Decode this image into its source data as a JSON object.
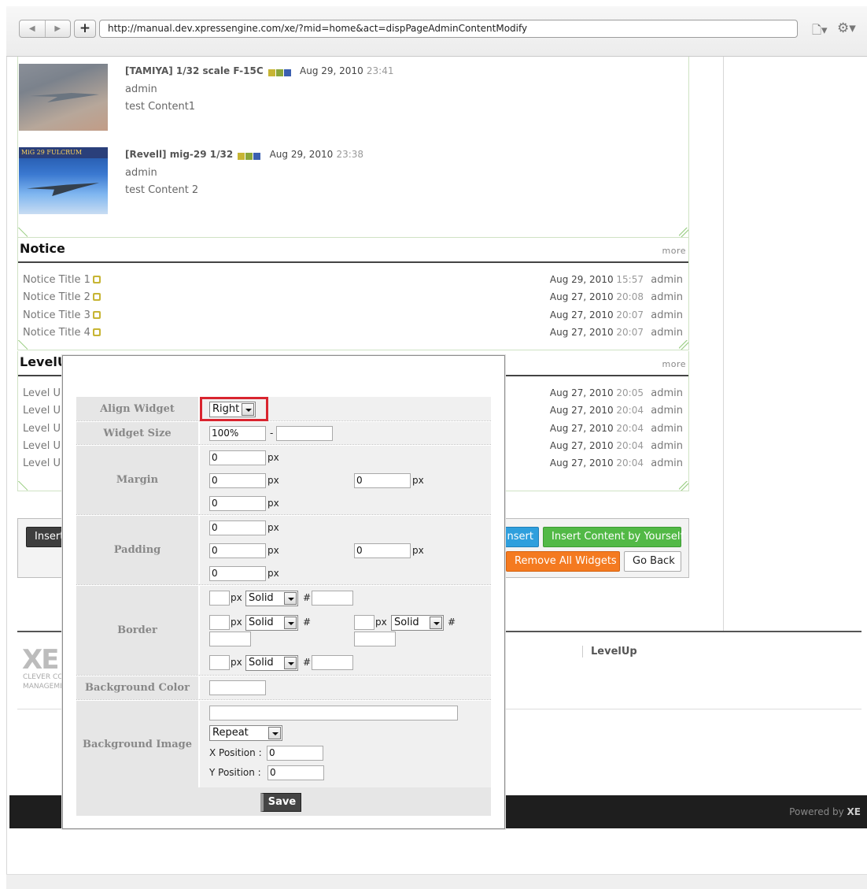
{
  "browser": {
    "url": "http://manual.dev.xpressengine.com/xe/?mid=home&act=dispPageAdminContentModify"
  },
  "gallery": {
    "items": [
      {
        "title": "[TAMIYA] 1/32 scale F-15C",
        "date": "Aug 29, 2010",
        "time": "23:41",
        "author": "admin",
        "content": "test Content1"
      },
      {
        "title": "[Revell] mig-29 1/32",
        "date": "Aug 29, 2010",
        "time": "23:38",
        "author": "admin",
        "content": "test Content 2",
        "thumb_caption": "MiG 29 FULCRUM"
      }
    ]
  },
  "notice": {
    "title": "Notice",
    "more": "more",
    "rows": [
      {
        "title": "Notice Title 1",
        "date": "Aug 29, 2010",
        "time": "15:57",
        "author": "admin"
      },
      {
        "title": "Notice Title 2",
        "date": "Aug 27, 2010",
        "time": "20:08",
        "author": "admin"
      },
      {
        "title": "Notice Title 3",
        "date": "Aug 27, 2010",
        "time": "20:07",
        "author": "admin"
      },
      {
        "title": "Notice Title 4",
        "date": "Aug 27, 2010",
        "time": "20:07",
        "author": "admin"
      }
    ]
  },
  "levelup": {
    "title": "LevelU",
    "more": "more",
    "rows": [
      {
        "title": "Level Up",
        "date": "Aug 27, 2010",
        "time": "20:05",
        "author": "admin"
      },
      {
        "title": "Level Up",
        "date": "Aug 27, 2010",
        "time": "20:04",
        "author": "admin"
      },
      {
        "title": "Level Up",
        "date": "Aug 27, 2010",
        "time": "20:04",
        "author": "admin"
      },
      {
        "title": "Level Up",
        "date": "Aug 27, 2010",
        "time": "20:04",
        "author": "admin"
      },
      {
        "title": "Level Up",
        "date": "Aug 27, 2010",
        "time": "20:04",
        "author": "admin"
      }
    ]
  },
  "buttons": {
    "insert": "Insert",
    "insert_widget": "nsert",
    "insert_content": "Insert Content by Yourself",
    "remove_all": "Remove All Widgets",
    "go_back": "Go Back"
  },
  "footer": {
    "logo": "XE",
    "tagline_1": "CLEVER CO",
    "tagline_2": "MANAGEME",
    "levelup_link": "LevelUp",
    "powered_prefix": "Powered by ",
    "powered_brand": "XE"
  },
  "modal": {
    "labels": {
      "align": "Align Widget",
      "size": "Widget Size",
      "margin": "Margin",
      "padding": "Padding",
      "border": "Border",
      "bg_color": "Background Color",
      "bg_image": "Background Image"
    },
    "align_value": "Right",
    "size_width": "100%",
    "size_sep": "-",
    "size_height": "",
    "unit_px": "px",
    "margin": {
      "top": "0",
      "left": "0",
      "right": "0",
      "bottom": "0"
    },
    "padding": {
      "top": "0",
      "left": "0",
      "right": "0",
      "bottom": "0"
    },
    "border_style": "Solid",
    "hash": "#",
    "bg_repeat": "Repeat",
    "x_position_label": "X Position :",
    "x_position": "0",
    "y_position_label": "Y Position :",
    "y_position": "0",
    "save": "Save"
  }
}
